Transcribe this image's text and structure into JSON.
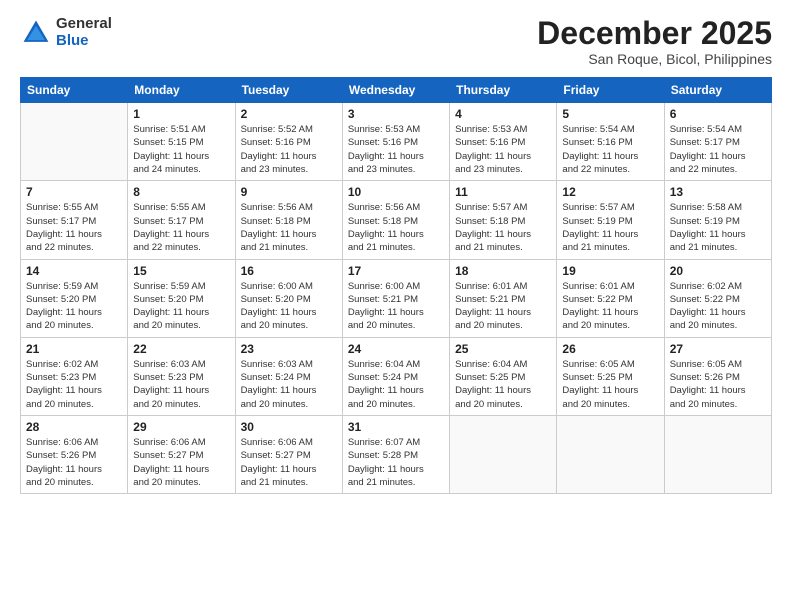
{
  "header": {
    "logo_general": "General",
    "logo_blue": "Blue",
    "month_title": "December 2025",
    "location": "San Roque, Bicol, Philippines"
  },
  "days_of_week": [
    "Sunday",
    "Monday",
    "Tuesday",
    "Wednesday",
    "Thursday",
    "Friday",
    "Saturday"
  ],
  "weeks": [
    [
      {
        "day": "",
        "info": ""
      },
      {
        "day": "1",
        "info": "Sunrise: 5:51 AM\nSunset: 5:15 PM\nDaylight: 11 hours\nand 24 minutes."
      },
      {
        "day": "2",
        "info": "Sunrise: 5:52 AM\nSunset: 5:16 PM\nDaylight: 11 hours\nand 23 minutes."
      },
      {
        "day": "3",
        "info": "Sunrise: 5:53 AM\nSunset: 5:16 PM\nDaylight: 11 hours\nand 23 minutes."
      },
      {
        "day": "4",
        "info": "Sunrise: 5:53 AM\nSunset: 5:16 PM\nDaylight: 11 hours\nand 23 minutes."
      },
      {
        "day": "5",
        "info": "Sunrise: 5:54 AM\nSunset: 5:16 PM\nDaylight: 11 hours\nand 22 minutes."
      },
      {
        "day": "6",
        "info": "Sunrise: 5:54 AM\nSunset: 5:17 PM\nDaylight: 11 hours\nand 22 minutes."
      }
    ],
    [
      {
        "day": "7",
        "info": "Sunrise: 5:55 AM\nSunset: 5:17 PM\nDaylight: 11 hours\nand 22 minutes."
      },
      {
        "day": "8",
        "info": "Sunrise: 5:55 AM\nSunset: 5:17 PM\nDaylight: 11 hours\nand 22 minutes."
      },
      {
        "day": "9",
        "info": "Sunrise: 5:56 AM\nSunset: 5:18 PM\nDaylight: 11 hours\nand 21 minutes."
      },
      {
        "day": "10",
        "info": "Sunrise: 5:56 AM\nSunset: 5:18 PM\nDaylight: 11 hours\nand 21 minutes."
      },
      {
        "day": "11",
        "info": "Sunrise: 5:57 AM\nSunset: 5:18 PM\nDaylight: 11 hours\nand 21 minutes."
      },
      {
        "day": "12",
        "info": "Sunrise: 5:57 AM\nSunset: 5:19 PM\nDaylight: 11 hours\nand 21 minutes."
      },
      {
        "day": "13",
        "info": "Sunrise: 5:58 AM\nSunset: 5:19 PM\nDaylight: 11 hours\nand 21 minutes."
      }
    ],
    [
      {
        "day": "14",
        "info": "Sunrise: 5:59 AM\nSunset: 5:20 PM\nDaylight: 11 hours\nand 20 minutes."
      },
      {
        "day": "15",
        "info": "Sunrise: 5:59 AM\nSunset: 5:20 PM\nDaylight: 11 hours\nand 20 minutes."
      },
      {
        "day": "16",
        "info": "Sunrise: 6:00 AM\nSunset: 5:20 PM\nDaylight: 11 hours\nand 20 minutes."
      },
      {
        "day": "17",
        "info": "Sunrise: 6:00 AM\nSunset: 5:21 PM\nDaylight: 11 hours\nand 20 minutes."
      },
      {
        "day": "18",
        "info": "Sunrise: 6:01 AM\nSunset: 5:21 PM\nDaylight: 11 hours\nand 20 minutes."
      },
      {
        "day": "19",
        "info": "Sunrise: 6:01 AM\nSunset: 5:22 PM\nDaylight: 11 hours\nand 20 minutes."
      },
      {
        "day": "20",
        "info": "Sunrise: 6:02 AM\nSunset: 5:22 PM\nDaylight: 11 hours\nand 20 minutes."
      }
    ],
    [
      {
        "day": "21",
        "info": "Sunrise: 6:02 AM\nSunset: 5:23 PM\nDaylight: 11 hours\nand 20 minutes."
      },
      {
        "day": "22",
        "info": "Sunrise: 6:03 AM\nSunset: 5:23 PM\nDaylight: 11 hours\nand 20 minutes."
      },
      {
        "day": "23",
        "info": "Sunrise: 6:03 AM\nSunset: 5:24 PM\nDaylight: 11 hours\nand 20 minutes."
      },
      {
        "day": "24",
        "info": "Sunrise: 6:04 AM\nSunset: 5:24 PM\nDaylight: 11 hours\nand 20 minutes."
      },
      {
        "day": "25",
        "info": "Sunrise: 6:04 AM\nSunset: 5:25 PM\nDaylight: 11 hours\nand 20 minutes."
      },
      {
        "day": "26",
        "info": "Sunrise: 6:05 AM\nSunset: 5:25 PM\nDaylight: 11 hours\nand 20 minutes."
      },
      {
        "day": "27",
        "info": "Sunrise: 6:05 AM\nSunset: 5:26 PM\nDaylight: 11 hours\nand 20 minutes."
      }
    ],
    [
      {
        "day": "28",
        "info": "Sunrise: 6:06 AM\nSunset: 5:26 PM\nDaylight: 11 hours\nand 20 minutes."
      },
      {
        "day": "29",
        "info": "Sunrise: 6:06 AM\nSunset: 5:27 PM\nDaylight: 11 hours\nand 20 minutes."
      },
      {
        "day": "30",
        "info": "Sunrise: 6:06 AM\nSunset: 5:27 PM\nDaylight: 11 hours\nand 21 minutes."
      },
      {
        "day": "31",
        "info": "Sunrise: 6:07 AM\nSunset: 5:28 PM\nDaylight: 11 hours\nand 21 minutes."
      },
      {
        "day": "",
        "info": ""
      },
      {
        "day": "",
        "info": ""
      },
      {
        "day": "",
        "info": ""
      }
    ]
  ]
}
